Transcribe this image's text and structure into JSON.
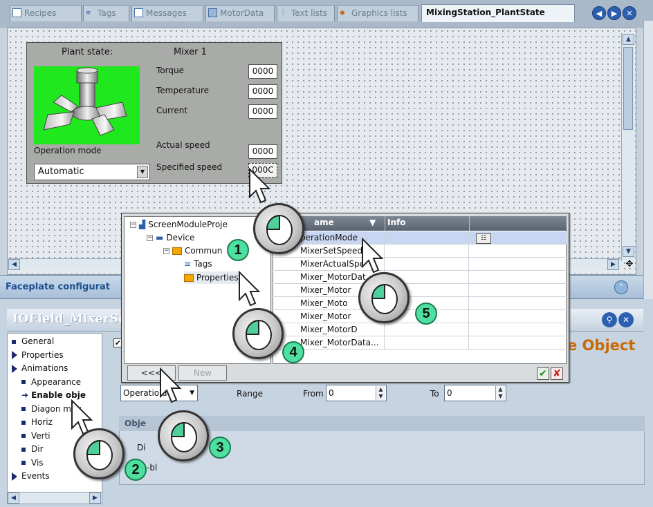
{
  "tabs": [
    {
      "label": "Recipes",
      "icon": "recipes-icon"
    },
    {
      "label": "Tags",
      "icon": "tags-icon"
    },
    {
      "label": "Messages",
      "icon": "messages-icon"
    },
    {
      "label": "MotorData",
      "icon": "motordata-icon"
    },
    {
      "label": "Text lists",
      "icon": "text-lists-icon"
    },
    {
      "label": "Graphics lists",
      "icon": "graphics-lists-icon"
    },
    {
      "label": "MixingStation_PlantState",
      "icon": "",
      "active": true
    }
  ],
  "faceplate": {
    "plant_state_label": "Plant state:",
    "mixer_title": "Mixer 1",
    "torque_label": "Torque",
    "torque_value": "0000",
    "temperature_label": "Temperature",
    "temperature_value": "0000",
    "current_label": "Current",
    "current_value": "0000",
    "actual_speed_label": "Actual speed",
    "actual_speed_value": "0000",
    "specified_speed_label": "Specified speed",
    "specified_speed_value": "000C",
    "operation_mode_label": "Operation mode",
    "operation_mode_value": "Automatic",
    "mixer_color": "#1fe81f"
  },
  "config_bar": {
    "label": "Faceplate configurat"
  },
  "properties": {
    "title": "IOField_MixerSe",
    "object_heading": "e Object",
    "nav": [
      {
        "label": "General",
        "type": "bullet",
        "indent": 0
      },
      {
        "label": "Properties",
        "type": "arrow",
        "indent": 0
      },
      {
        "label": "Animations",
        "type": "arrow-open",
        "indent": 0
      },
      {
        "label": "Appearance",
        "type": "bullet",
        "indent": 1
      },
      {
        "label": "Enable obje",
        "type": "selected",
        "indent": 1
      },
      {
        "label": "Diagon   mov",
        "type": "bullet",
        "indent": 1
      },
      {
        "label": "Horiz",
        "type": "bullet",
        "indent": 1
      },
      {
        "label": "Verti",
        "type": "bullet",
        "indent": 1
      },
      {
        "label": "Dir",
        "type": "bullet",
        "indent": 1
      },
      {
        "label": "Vis",
        "type": "bullet",
        "indent": 1
      },
      {
        "label": "Events",
        "type": "arrow",
        "indent": 0
      }
    ],
    "operation_field": "Operatio     de",
    "range_label": "Range",
    "from_label": "From",
    "from_value": "0",
    "to_label": "To",
    "to_value": "0",
    "object_group_label": "Obje",
    "obj_row1": "Di",
    "obj_row2": "-bl"
  },
  "dialog": {
    "tree": [
      {
        "label": "ScreenModuleProje",
        "level": 0,
        "icon": "project-icon",
        "expander": "-"
      },
      {
        "label": "Device",
        "level": 1,
        "icon": "device-icon",
        "expander": "-"
      },
      {
        "label": "Commun",
        "level": 2,
        "icon": "folder-icon",
        "expander": "-"
      },
      {
        "label": "Tags",
        "level": 3,
        "icon": "tags-icon",
        "expander": ""
      },
      {
        "label": "Properties",
        "level": 3,
        "icon": "folder-icon",
        "expander": "",
        "selected": true
      }
    ],
    "columns": {
      "name": "ame",
      "info": "Info"
    },
    "rows": [
      "perationMode",
      "MixerSetSpeed",
      "MixerActualSpe",
      "Mixer_MotorDat",
      "Mixer_Motor",
      "Mixer_Moto",
      "Mixer_Motor",
      "Mixer_MotorD",
      "Mixer_MotorData..."
    ],
    "back_button": "<<<",
    "new_button": "New",
    "ok_symbol": "✔",
    "cancel_symbol": "✘"
  },
  "callouts": [
    "1",
    "2",
    "3",
    "4",
    "5"
  ]
}
